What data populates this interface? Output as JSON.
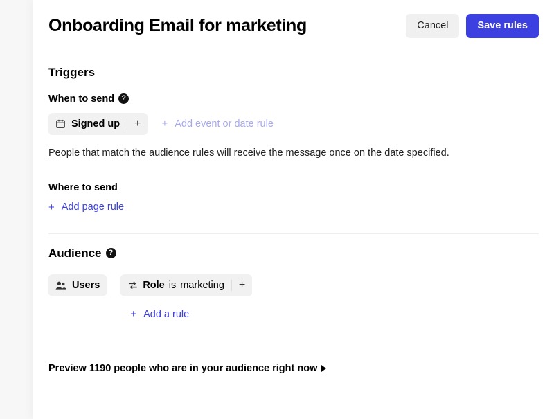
{
  "header": {
    "title": "Onboarding Email for marketing",
    "cancel_label": "Cancel",
    "save_label": "Save rules"
  },
  "triggers": {
    "title": "Triggers",
    "when_label": "When to send",
    "when_rule": "Signed up",
    "add_event_label": "Add event or date rule",
    "description": "People that match the audience rules will receive the message once on the date specified.",
    "where_label": "Where to send",
    "add_page_label": "Add page rule"
  },
  "audience": {
    "title": "Audience",
    "users_label": "Users",
    "rule_field": "Role",
    "rule_operator": "is",
    "rule_value": "marketing",
    "add_rule_label": "Add a rule"
  },
  "preview": {
    "prefix": "Preview ",
    "count": "1190",
    "suffix": " people who are in your audience right now"
  }
}
